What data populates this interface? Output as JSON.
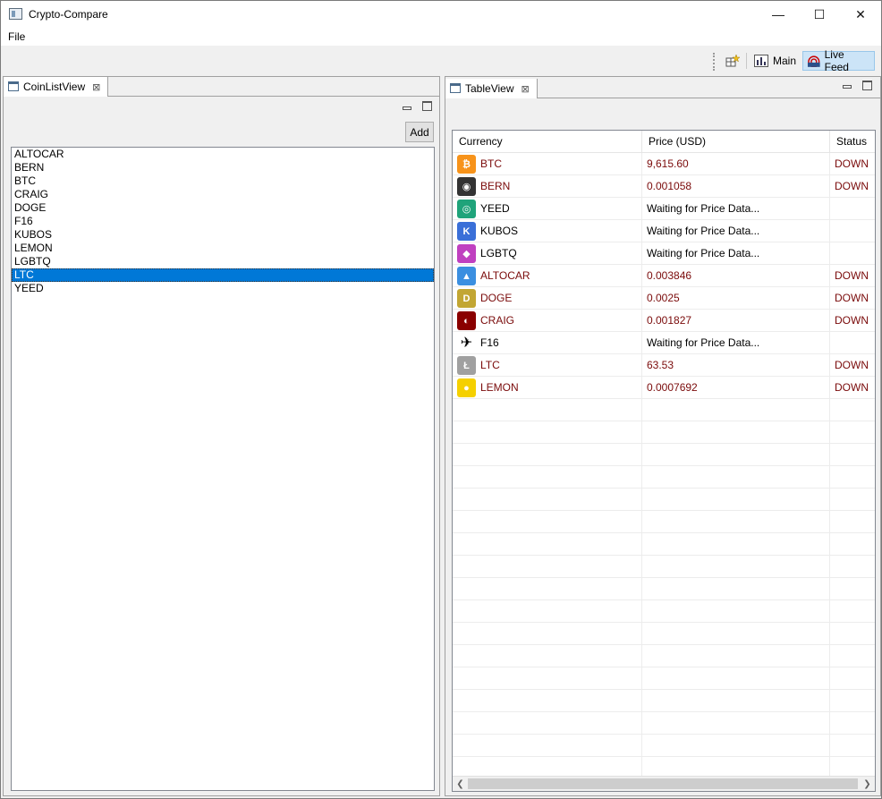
{
  "window": {
    "title": "Crypto-Compare",
    "minimize_glyph": "—",
    "maximize_glyph": "☐",
    "close_glyph": "✕"
  },
  "menu": {
    "file": "File"
  },
  "toolbar": {
    "main_label": "Main",
    "livefeed_label": "Live Feed"
  },
  "coinlist_view": {
    "tab_label": "CoinListView",
    "add_label": "Add",
    "items": [
      "ALTOCAR",
      "BERN",
      "BTC",
      "CRAIG",
      "DOGE",
      "F16",
      "KUBOS",
      "LEMON",
      "LGBTQ",
      "LTC",
      "YEED"
    ],
    "selected": "LTC"
  },
  "table_view": {
    "tab_label": "TableView",
    "columns": [
      "Currency",
      "Price (USD)",
      "Status"
    ],
    "rows": [
      {
        "currency": "BTC",
        "price": "9,615.60",
        "status": "DOWN",
        "icon": "bitcoin-icon",
        "color": "#f7931a",
        "glyph": "₿"
      },
      {
        "currency": "BERN",
        "price": "0.001058",
        "status": "DOWN",
        "icon": "bern-icon",
        "color": "#333333",
        "glyph": "◉"
      },
      {
        "currency": "YEED",
        "price": "Waiting for Price Data...",
        "status": "",
        "icon": "yeed-icon",
        "color": "#1fa37a",
        "glyph": "◎"
      },
      {
        "currency": "KUBOS",
        "price": "Waiting for Price Data...",
        "status": "",
        "icon": "kubos-icon",
        "color": "#3a6fd8",
        "glyph": "K"
      },
      {
        "currency": "LGBTQ",
        "price": "Waiting for Price Data...",
        "status": "",
        "icon": "lgbtq-icon",
        "color": "#c040c0",
        "glyph": "◆"
      },
      {
        "currency": "ALTOCAR",
        "price": "0.003846",
        "status": "DOWN",
        "icon": "altocar-icon",
        "color": "#3b8fe0",
        "glyph": "▲"
      },
      {
        "currency": "DOGE",
        "price": "0.0025",
        "status": "DOWN",
        "icon": "doge-icon",
        "color": "#c2a633",
        "glyph": "D"
      },
      {
        "currency": "CRAIG",
        "price": "0.001827",
        "status": "DOWN",
        "icon": "craig-icon",
        "color": "#8a0000",
        "glyph": "◐"
      },
      {
        "currency": "F16",
        "price": "Waiting for Price Data...",
        "status": "",
        "icon": "jet-icon",
        "color": "#ffffff",
        "glyph": "✈"
      },
      {
        "currency": "LTC",
        "price": "63.53",
        "status": "DOWN",
        "icon": "litecoin-icon",
        "color": "#a0a0a0",
        "glyph": "Ł"
      },
      {
        "currency": "LEMON",
        "price": "0.0007692",
        "status": "DOWN",
        "icon": "lemon-icon",
        "color": "#f5d000",
        "glyph": "●"
      }
    ]
  }
}
